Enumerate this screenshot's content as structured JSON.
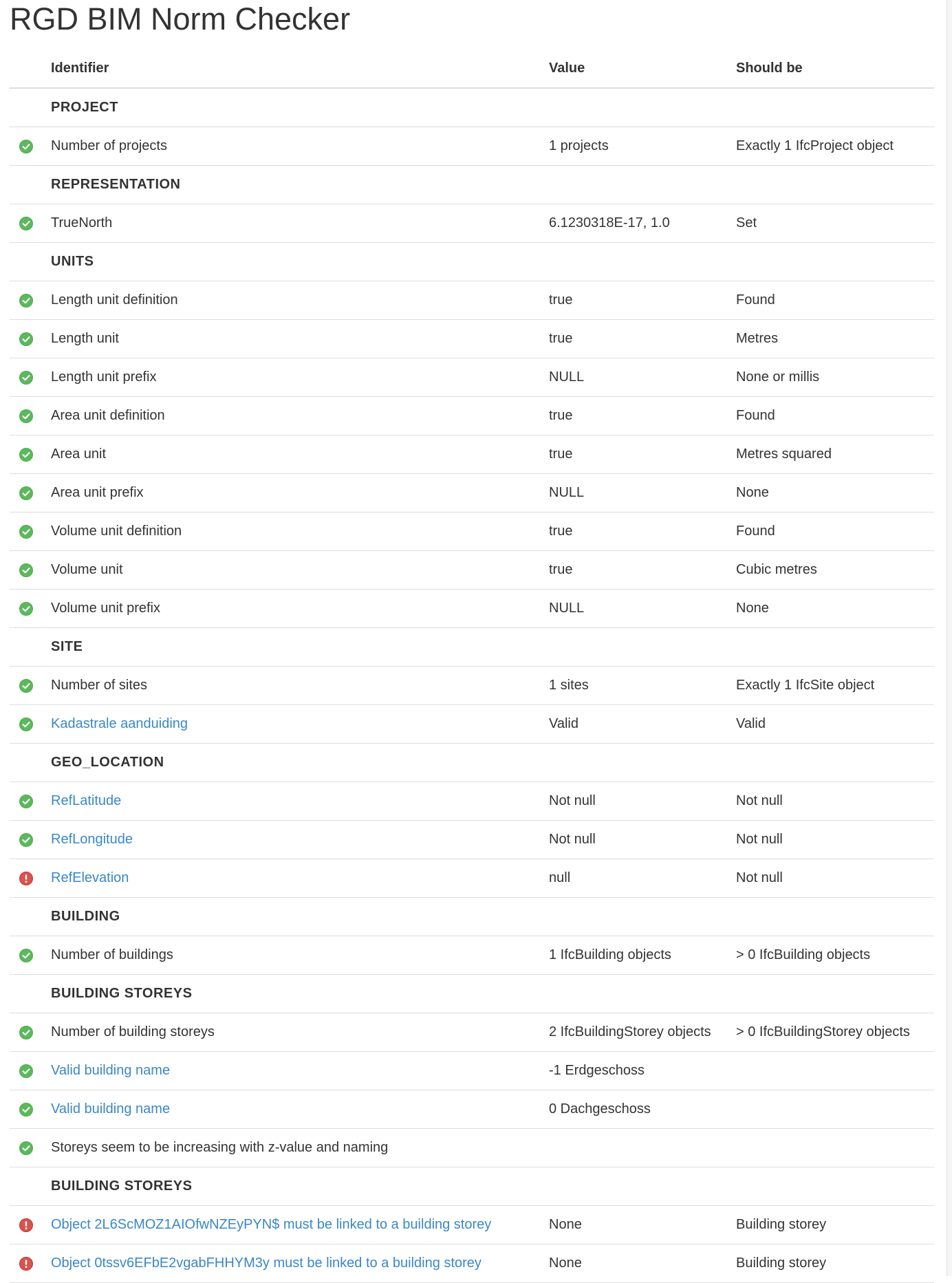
{
  "app": {
    "title": "RGD BIM Norm Checker"
  },
  "colors": {
    "ok": "#5cb85c",
    "error": "#d9534f",
    "link": "#3a87c8",
    "text": "#333333",
    "rule": "#dddddd"
  },
  "table": {
    "headers": {
      "identifier": "Identifier",
      "value": "Value",
      "should_be": "Should be"
    },
    "rows": [
      {
        "type": "section",
        "label": "PROJECT"
      },
      {
        "type": "check",
        "status": "ok",
        "icon": "check-circle-icon",
        "identifier": "Number of projects",
        "link": false,
        "value": "1 projects",
        "should_be": "Exactly 1 IfcProject object"
      },
      {
        "type": "section",
        "label": "REPRESENTATION"
      },
      {
        "type": "check",
        "status": "ok",
        "icon": "check-circle-icon",
        "identifier": "TrueNorth",
        "link": false,
        "value": "6.1230318E-17, 1.0",
        "should_be": "Set"
      },
      {
        "type": "section",
        "label": "UNITS"
      },
      {
        "type": "check",
        "status": "ok",
        "icon": "check-circle-icon",
        "identifier": "Length unit definition",
        "link": false,
        "value": "true",
        "should_be": "Found"
      },
      {
        "type": "check",
        "status": "ok",
        "icon": "check-circle-icon",
        "identifier": "Length unit",
        "link": false,
        "value": "true",
        "should_be": "Metres"
      },
      {
        "type": "check",
        "status": "ok",
        "icon": "check-circle-icon",
        "identifier": "Length unit prefix",
        "link": false,
        "value": "NULL",
        "should_be": "None or millis"
      },
      {
        "type": "check",
        "status": "ok",
        "icon": "check-circle-icon",
        "identifier": "Area unit definition",
        "link": false,
        "value": "true",
        "should_be": "Found"
      },
      {
        "type": "check",
        "status": "ok",
        "icon": "check-circle-icon",
        "identifier": "Area unit",
        "link": false,
        "value": "true",
        "should_be": "Metres squared"
      },
      {
        "type": "check",
        "status": "ok",
        "icon": "check-circle-icon",
        "identifier": "Area unit prefix",
        "link": false,
        "value": "NULL",
        "should_be": "None"
      },
      {
        "type": "check",
        "status": "ok",
        "icon": "check-circle-icon",
        "identifier": "Volume unit definition",
        "link": false,
        "value": "true",
        "should_be": "Found"
      },
      {
        "type": "check",
        "status": "ok",
        "icon": "check-circle-icon",
        "identifier": "Volume unit",
        "link": false,
        "value": "true",
        "should_be": "Cubic metres"
      },
      {
        "type": "check",
        "status": "ok",
        "icon": "check-circle-icon",
        "identifier": "Volume unit prefix",
        "link": false,
        "value": "NULL",
        "should_be": "None"
      },
      {
        "type": "section",
        "label": "SITE"
      },
      {
        "type": "check",
        "status": "ok",
        "icon": "check-circle-icon",
        "identifier": "Number of sites",
        "link": false,
        "value": "1 sites",
        "should_be": "Exactly 1 IfcSite object"
      },
      {
        "type": "check",
        "status": "ok",
        "icon": "check-circle-icon",
        "identifier": "Kadastrale aanduiding",
        "link": true,
        "value": "Valid",
        "should_be": "Valid"
      },
      {
        "type": "section",
        "label": "GEO_LOCATION"
      },
      {
        "type": "check",
        "status": "ok",
        "icon": "check-circle-icon",
        "identifier": "RefLatitude",
        "link": true,
        "value": "Not null",
        "should_be": "Not null"
      },
      {
        "type": "check",
        "status": "ok",
        "icon": "check-circle-icon",
        "identifier": "RefLongitude",
        "link": true,
        "value": "Not null",
        "should_be": "Not null"
      },
      {
        "type": "check",
        "status": "error",
        "icon": "error-circle-icon",
        "identifier": "RefElevation",
        "link": true,
        "value": "null",
        "should_be": "Not null"
      },
      {
        "type": "section",
        "label": "BUILDING"
      },
      {
        "type": "check",
        "status": "ok",
        "icon": "check-circle-icon",
        "identifier": "Number of buildings",
        "link": false,
        "value": "1 IfcBuilding objects",
        "should_be": "> 0 IfcBuilding objects"
      },
      {
        "type": "section",
        "label": "BUILDING STOREYS"
      },
      {
        "type": "check",
        "status": "ok",
        "icon": "check-circle-icon",
        "identifier": "Number of building storeys",
        "link": false,
        "value": "2 IfcBuildingStorey objects",
        "should_be": "> 0 IfcBuildingStorey objects"
      },
      {
        "type": "check",
        "status": "ok",
        "icon": "check-circle-icon",
        "identifier": "Valid building name",
        "link": true,
        "value": "-1 Erdgeschoss",
        "should_be": ""
      },
      {
        "type": "check",
        "status": "ok",
        "icon": "check-circle-icon",
        "identifier": "Valid building name",
        "link": true,
        "value": "0 Dachgeschoss",
        "should_be": ""
      },
      {
        "type": "check",
        "status": "ok",
        "icon": "check-circle-icon",
        "identifier": "Storeys seem to be increasing with z-value and naming",
        "link": false,
        "value": "",
        "should_be": ""
      },
      {
        "type": "section",
        "label": "BUILDING STOREYS"
      },
      {
        "type": "check",
        "status": "error",
        "icon": "error-circle-icon",
        "identifier": "Object 2L6ScMOZ1AIOfwNZEyPYN$ must be linked to a building storey",
        "link": true,
        "value": "None",
        "should_be": "Building storey"
      },
      {
        "type": "check",
        "status": "error",
        "icon": "error-circle-icon",
        "identifier": "Object 0tssv6EFbE2vgabFHHYM3y must be linked to a building storey",
        "link": true,
        "value": "None",
        "should_be": "Building storey"
      }
    ]
  }
}
